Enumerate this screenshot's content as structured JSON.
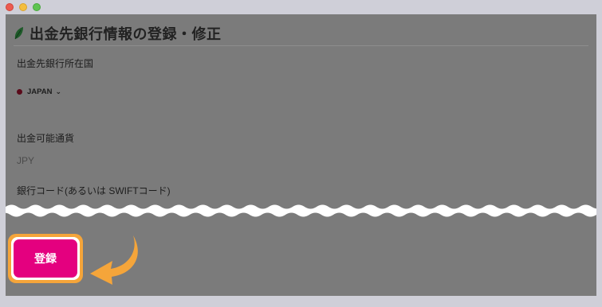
{
  "window": {
    "controls": [
      "close",
      "minimize",
      "maximize"
    ]
  },
  "page": {
    "title": "出金先銀行情報の登録・修正",
    "icon": "leaf-icon"
  },
  "form": {
    "country_label": "出金先銀行所在国",
    "country_value": "JAPAN",
    "currency_label": "出金可能通貨",
    "currency_value": "JPY",
    "bank_code_label": "銀行コード(あるいは SWIFTコード)"
  },
  "actions": {
    "register_label": "登録"
  },
  "colors": {
    "accent_button": "#e4007f",
    "highlight_ring": "#f5a53a",
    "overlay": "#7b7b7b"
  }
}
